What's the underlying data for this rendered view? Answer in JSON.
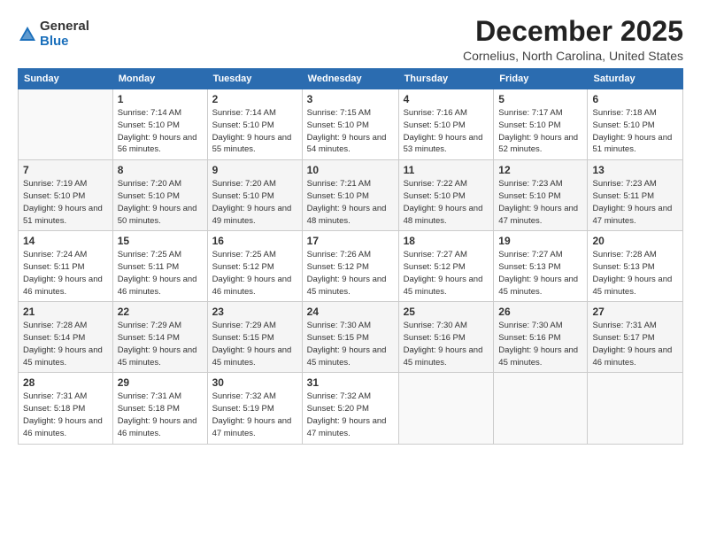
{
  "logo": {
    "general": "General",
    "blue": "Blue"
  },
  "header": {
    "month": "December 2025",
    "location": "Cornelius, North Carolina, United States"
  },
  "weekdays": [
    "Sunday",
    "Monday",
    "Tuesday",
    "Wednesday",
    "Thursday",
    "Friday",
    "Saturday"
  ],
  "weeks": [
    [
      {
        "day": "",
        "info": ""
      },
      {
        "day": "1",
        "info": "Sunrise: 7:14 AM\nSunset: 5:10 PM\nDaylight: 9 hours\nand 56 minutes."
      },
      {
        "day": "2",
        "info": "Sunrise: 7:14 AM\nSunset: 5:10 PM\nDaylight: 9 hours\nand 55 minutes."
      },
      {
        "day": "3",
        "info": "Sunrise: 7:15 AM\nSunset: 5:10 PM\nDaylight: 9 hours\nand 54 minutes."
      },
      {
        "day": "4",
        "info": "Sunrise: 7:16 AM\nSunset: 5:10 PM\nDaylight: 9 hours\nand 53 minutes."
      },
      {
        "day": "5",
        "info": "Sunrise: 7:17 AM\nSunset: 5:10 PM\nDaylight: 9 hours\nand 52 minutes."
      },
      {
        "day": "6",
        "info": "Sunrise: 7:18 AM\nSunset: 5:10 PM\nDaylight: 9 hours\nand 51 minutes."
      }
    ],
    [
      {
        "day": "7",
        "info": "Sunrise: 7:19 AM\nSunset: 5:10 PM\nDaylight: 9 hours\nand 51 minutes."
      },
      {
        "day": "8",
        "info": "Sunrise: 7:20 AM\nSunset: 5:10 PM\nDaylight: 9 hours\nand 50 minutes."
      },
      {
        "day": "9",
        "info": "Sunrise: 7:20 AM\nSunset: 5:10 PM\nDaylight: 9 hours\nand 49 minutes."
      },
      {
        "day": "10",
        "info": "Sunrise: 7:21 AM\nSunset: 5:10 PM\nDaylight: 9 hours\nand 48 minutes."
      },
      {
        "day": "11",
        "info": "Sunrise: 7:22 AM\nSunset: 5:10 PM\nDaylight: 9 hours\nand 48 minutes."
      },
      {
        "day": "12",
        "info": "Sunrise: 7:23 AM\nSunset: 5:10 PM\nDaylight: 9 hours\nand 47 minutes."
      },
      {
        "day": "13",
        "info": "Sunrise: 7:23 AM\nSunset: 5:11 PM\nDaylight: 9 hours\nand 47 minutes."
      }
    ],
    [
      {
        "day": "14",
        "info": "Sunrise: 7:24 AM\nSunset: 5:11 PM\nDaylight: 9 hours\nand 46 minutes."
      },
      {
        "day": "15",
        "info": "Sunrise: 7:25 AM\nSunset: 5:11 PM\nDaylight: 9 hours\nand 46 minutes."
      },
      {
        "day": "16",
        "info": "Sunrise: 7:25 AM\nSunset: 5:12 PM\nDaylight: 9 hours\nand 46 minutes."
      },
      {
        "day": "17",
        "info": "Sunrise: 7:26 AM\nSunset: 5:12 PM\nDaylight: 9 hours\nand 45 minutes."
      },
      {
        "day": "18",
        "info": "Sunrise: 7:27 AM\nSunset: 5:12 PM\nDaylight: 9 hours\nand 45 minutes."
      },
      {
        "day": "19",
        "info": "Sunrise: 7:27 AM\nSunset: 5:13 PM\nDaylight: 9 hours\nand 45 minutes."
      },
      {
        "day": "20",
        "info": "Sunrise: 7:28 AM\nSunset: 5:13 PM\nDaylight: 9 hours\nand 45 minutes."
      }
    ],
    [
      {
        "day": "21",
        "info": "Sunrise: 7:28 AM\nSunset: 5:14 PM\nDaylight: 9 hours\nand 45 minutes."
      },
      {
        "day": "22",
        "info": "Sunrise: 7:29 AM\nSunset: 5:14 PM\nDaylight: 9 hours\nand 45 minutes."
      },
      {
        "day": "23",
        "info": "Sunrise: 7:29 AM\nSunset: 5:15 PM\nDaylight: 9 hours\nand 45 minutes."
      },
      {
        "day": "24",
        "info": "Sunrise: 7:30 AM\nSunset: 5:15 PM\nDaylight: 9 hours\nand 45 minutes."
      },
      {
        "day": "25",
        "info": "Sunrise: 7:30 AM\nSunset: 5:16 PM\nDaylight: 9 hours\nand 45 minutes."
      },
      {
        "day": "26",
        "info": "Sunrise: 7:30 AM\nSunset: 5:16 PM\nDaylight: 9 hours\nand 45 minutes."
      },
      {
        "day": "27",
        "info": "Sunrise: 7:31 AM\nSunset: 5:17 PM\nDaylight: 9 hours\nand 46 minutes."
      }
    ],
    [
      {
        "day": "28",
        "info": "Sunrise: 7:31 AM\nSunset: 5:18 PM\nDaylight: 9 hours\nand 46 minutes."
      },
      {
        "day": "29",
        "info": "Sunrise: 7:31 AM\nSunset: 5:18 PM\nDaylight: 9 hours\nand 46 minutes."
      },
      {
        "day": "30",
        "info": "Sunrise: 7:32 AM\nSunset: 5:19 PM\nDaylight: 9 hours\nand 47 minutes."
      },
      {
        "day": "31",
        "info": "Sunrise: 7:32 AM\nSunset: 5:20 PM\nDaylight: 9 hours\nand 47 minutes."
      },
      {
        "day": "",
        "info": ""
      },
      {
        "day": "",
        "info": ""
      },
      {
        "day": "",
        "info": ""
      }
    ]
  ]
}
